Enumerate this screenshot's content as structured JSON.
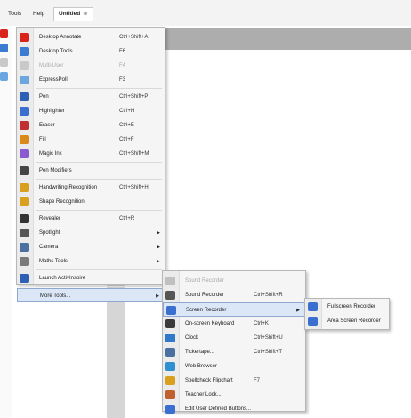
{
  "menubar": {
    "tools": "Tools",
    "help": "Help",
    "tab_title": "Untitled",
    "tab_close": "⊗"
  },
  "main_menu": {
    "items": [
      {
        "label": "Desktop Annotate",
        "shortcut": "Ctrl+Shift+A",
        "icon": "desktop-annotate-icon",
        "color": "#d9241c"
      },
      {
        "label": "Desktop Tools",
        "shortcut": "F6",
        "icon": "desktop-tools-icon",
        "color": "#3b7bd1"
      },
      {
        "label": "Multi-User",
        "shortcut": "F4",
        "icon": "multi-user-icon",
        "color": "#c9c9c9",
        "disabled": true
      },
      {
        "label": "ExpressPoll",
        "shortcut": "F3",
        "icon": "expresspoll-icon",
        "color": "#6aa6e0"
      },
      {
        "label": "Pen",
        "shortcut": "Ctrl+Shift+P",
        "icon": "pen-icon",
        "color": "#2d5fb3"
      },
      {
        "label": "Highlighter",
        "shortcut": "Ctrl+H",
        "icon": "highlighter-icon",
        "color": "#3a6fd0"
      },
      {
        "label": "Eraser",
        "shortcut": "Ctrl+E",
        "icon": "eraser-icon",
        "color": "#c03030"
      },
      {
        "label": "Fill",
        "shortcut": "Ctrl+F",
        "icon": "fill-icon",
        "color": "#d98a1a"
      },
      {
        "label": "Magic Ink",
        "shortcut": "Ctrl+Shift+M",
        "icon": "magic-ink-icon",
        "color": "#8a5bd0"
      },
      {
        "label": "Pen Modifiers",
        "shortcut": "",
        "icon": "pen-modifiers-icon",
        "color": "#444444"
      },
      {
        "label": "Handwriting Recognition",
        "shortcut": "Ctrl+Shift+H",
        "icon": "handwriting-recognition-icon",
        "color": "#d9a020"
      },
      {
        "label": "Shape Recognition",
        "shortcut": "",
        "icon": "shape-recognition-icon",
        "color": "#d9a020"
      },
      {
        "label": "Revealer",
        "shortcut": "Ctrl+R",
        "icon": "revealer-icon",
        "color": "#333333"
      },
      {
        "label": "Spotlight",
        "shortcut": "",
        "icon": "spotlight-icon",
        "color": "#555555",
        "arrow": true
      },
      {
        "label": "Camera",
        "shortcut": "",
        "icon": "camera-icon",
        "color": "#4a6fa0",
        "arrow": true
      },
      {
        "label": "Maths Tools",
        "shortcut": "",
        "icon": "maths-tools-icon",
        "color": "#7a7a7a",
        "arrow": true
      },
      {
        "label": "Launch ActivInspire",
        "shortcut": "",
        "icon": "launch-activinspire-icon",
        "color": "#2d5fb3"
      },
      {
        "label": "More Tools...",
        "shortcut": "",
        "icon": "",
        "arrow": true,
        "selected": true
      }
    ]
  },
  "more_tools_menu": {
    "items": [
      {
        "label": "Sound Recorder",
        "shortcut": "",
        "icon": "sound-recorder-disabled-icon",
        "color": "#c0c0c0",
        "disabled": true
      },
      {
        "label": "Sound Recorder",
        "shortcut": "Ctrl+Shift+R",
        "icon": "sound-recorder-icon",
        "color": "#555555"
      },
      {
        "label": "Screen Recorder",
        "shortcut": "",
        "icon": "screen-recorder-icon",
        "color": "#3a6fd0",
        "arrow": true,
        "selected": true
      },
      {
        "label": "On-screen Keyboard",
        "shortcut": "Ctrl+K",
        "icon": "keyboard-icon",
        "color": "#3b3b3b"
      },
      {
        "label": "Clock",
        "shortcut": "Ctrl+Shift+U",
        "icon": "clock-icon",
        "color": "#2f79c8"
      },
      {
        "label": "Tickertape...",
        "shortcut": "Ctrl+Shift+T",
        "icon": "tickertape-icon",
        "color": "#4a6fa0"
      },
      {
        "label": "Web Browser",
        "shortcut": "",
        "icon": "web-browser-icon",
        "color": "#2f8fd0"
      },
      {
        "label": "Spellcheck Flipchart",
        "shortcut": "F7",
        "icon": "spellcheck-icon",
        "color": "#d9a020"
      },
      {
        "label": "Teacher Lock...",
        "shortcut": "",
        "icon": "teacher-lock-icon",
        "color": "#c06030"
      },
      {
        "label": "Edit User Defined Buttons...",
        "shortcut": "",
        "icon": "edit-buttons-icon",
        "color": "#3a6fd0"
      }
    ]
  },
  "screen_recorder_menu": {
    "items": [
      {
        "label": "Fullscreen Recorder",
        "icon": "fullscreen-recorder-icon",
        "color": "#3a6fd0"
      },
      {
        "label": "Area Screen Recorder",
        "icon": "area-screen-recorder-icon",
        "color": "#3a6fd0"
      }
    ]
  },
  "toolbar_colors": [
    "#d9241c",
    "#3b7bd1",
    "#c9c9c9",
    "#6aa6e0",
    "#2d5fb3",
    "#3a6fd0"
  ]
}
